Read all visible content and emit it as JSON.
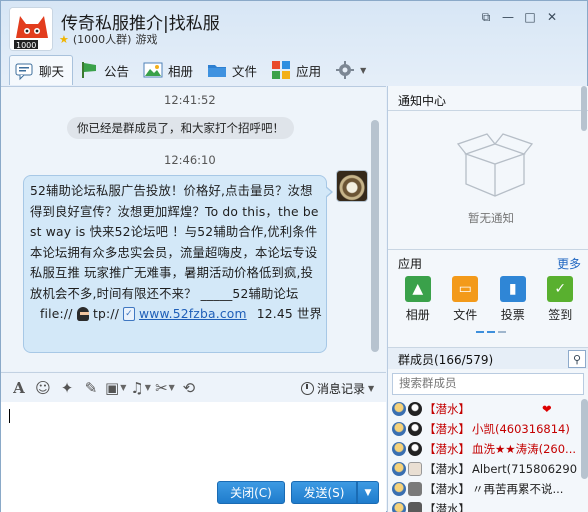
{
  "window": {
    "title": "传奇私服推介|找私服",
    "member_count": "(1000人群)",
    "category": "游戏",
    "controls": [
      "minimize",
      "restore",
      "maximize",
      "close"
    ]
  },
  "toolbar": {
    "tabs": [
      {
        "label": "聊天",
        "icon": "chat-icon"
      },
      {
        "label": "公告",
        "icon": "announcement-icon"
      },
      {
        "label": "相册",
        "icon": "album-icon"
      },
      {
        "label": "文件",
        "icon": "folder-icon"
      },
      {
        "label": "应用",
        "icon": "apps-icon"
      }
    ],
    "settings_icon": "gear-icon"
  },
  "chat": {
    "time1": "12:41:52",
    "system_message": "你已经是群成员了，和大家打个招呼吧！",
    "time2": "12:46:10",
    "message_text": "52辅助论坛私服广告投放！价格好,点击量员？汝想得到良好宣传？汝想更加辉煌？To do this，the best way is 快来52论坛吧 ！与52辅助合作,优利条件 本论坛拥有众多忠实会员，流量超嗨皮，本论坛专设私服互推 玩家推广无难事，暑期活动价格低到疯,投放机会不多,时间有限还不来？ _____52辅助论坛",
    "last_line_prefix": "file://",
    "last_line_mid": "tp://",
    "link": "www.52fzba.com",
    "last_line_suffix": "12.45 世界"
  },
  "input_toolbar": {
    "icons": [
      "font-icon",
      "emoji-icon",
      "magic-icon",
      "edit-icon",
      "image-icon",
      "audio-icon",
      "screenshot-icon",
      "shake-icon"
    ],
    "history_label": "消息记录"
  },
  "buttons": {
    "close": "关闭(C)",
    "send": "发送(S)"
  },
  "right": {
    "notice_title": "通知中心",
    "no_notice": "暂无通知",
    "apps_title": "应用",
    "more": "更多",
    "apps": [
      {
        "label": "相册",
        "color": "#3aa14a",
        "icon": "photo-icon"
      },
      {
        "label": "文件",
        "color": "#f39a1a",
        "icon": "folder-icon"
      },
      {
        "label": "投票",
        "color": "#2f86d6",
        "icon": "vote-icon"
      },
      {
        "label": "签到",
        "color": "#59b02f",
        "icon": "checkin-icon"
      }
    ],
    "members_title": "群成员(166/579)",
    "search_placeholder": "搜索群成员",
    "members": [
      {
        "tag": "【潜水】",
        "name": "",
        "extra": "❤"
      },
      {
        "tag": "【潜水】",
        "name": "小凯(460316814)",
        "extra": ""
      },
      {
        "tag": "【潜水】",
        "name": "血洗★★涛涛(260...",
        "extra": ""
      },
      {
        "tag": "【潜水】",
        "name": "Albert(715806290)",
        "extra": ""
      },
      {
        "tag": "【潜水】",
        "name": "〃再苦再累不说...",
        "extra": ""
      },
      {
        "tag": "【潜水】",
        "name": "",
        "extra": ""
      }
    ]
  }
}
